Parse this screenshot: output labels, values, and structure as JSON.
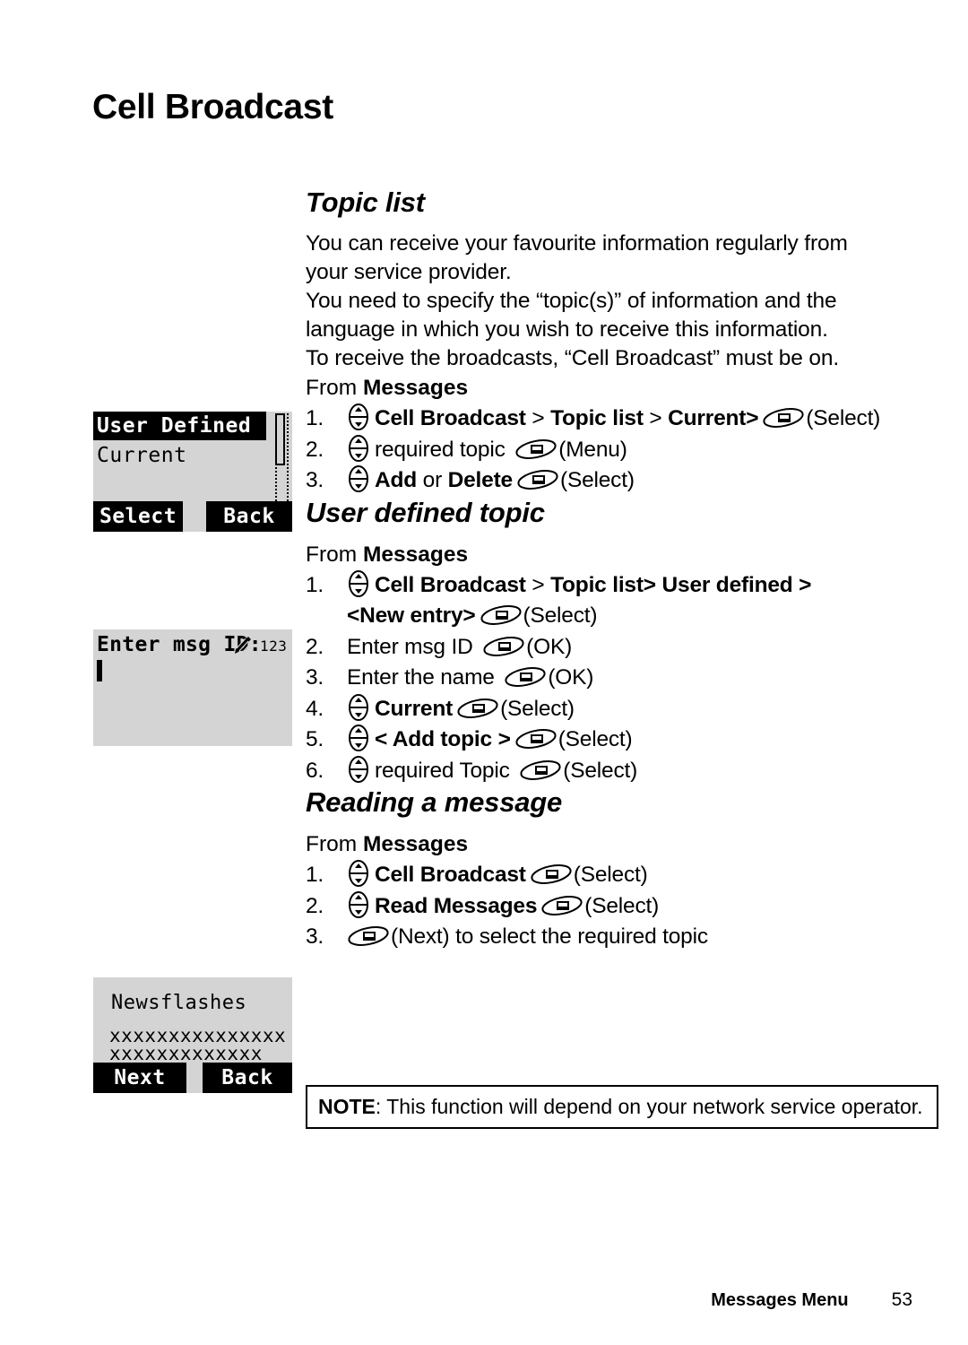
{
  "document": {
    "title": "Cell Broadcast",
    "footer": {
      "chapter": "Messages Menu",
      "page_number": "53"
    },
    "note": {
      "label": "NOTE",
      "text": ": This function will depend on your network service operator."
    }
  },
  "icons": {
    "nav_key": "nav-updown-key-icon",
    "soft_key": "softkey-icon",
    "pencil": "pencil-edit-icon"
  },
  "sections": {
    "topic_list": {
      "heading": "Topic list",
      "paragraph_lines": [
        "You can receive your favourite information regularly from",
        "your service provider.",
        "You need to specify the “topic(s)” of information and the",
        "language in which you wish to receive this information.",
        "To receive the broadcasts, “Cell Broadcast” must be on."
      ],
      "from_prefix": "From ",
      "from_target": "Messages",
      "steps": [
        {
          "num": "1.",
          "bold1": "Cell Broadcast",
          "plain1": " > ",
          "bold2": "Topic list",
          "plain2": " > ",
          "bold3": "Current>",
          "key": "(Select)"
        },
        {
          "num": "2.",
          "plain": "required topic ",
          "key": "(Menu)"
        },
        {
          "num": "3.",
          "bold1": "Add",
          "plain1": " or ",
          "bold2": "Delete",
          "key": "(Select)"
        }
      ]
    },
    "user_defined_topic": {
      "heading": "User defined topic",
      "from_prefix": "From ",
      "from_target": "Messages",
      "steps": [
        {
          "num": "1.",
          "bold1": "Cell Broadcast",
          "plain1": " > ",
          "bold2": "Topic list> User defined >",
          "line2_bold": "<New entry>",
          "key": "(Select)"
        },
        {
          "num": "2.",
          "plain": "Enter msg ID ",
          "key": "(OK)"
        },
        {
          "num": "3.",
          "plain": "Enter the name ",
          "key": "(OK)"
        },
        {
          "num": "4.",
          "bold1": "Current",
          "key": "(Select)"
        },
        {
          "num": "5.",
          "bold1": "< Add topic >",
          "key": "(Select)"
        },
        {
          "num": "6.",
          "plain": "required Topic ",
          "key": "(Select)"
        }
      ]
    },
    "reading_a_message": {
      "heading": "Reading a message",
      "from_prefix": "From ",
      "from_target": "Messages",
      "steps": [
        {
          "num": "1.",
          "bold1": "Cell Broadcast",
          "key": "(Select)"
        },
        {
          "num": "2.",
          "bold1": "Read Messages",
          "key": "(Select)"
        },
        {
          "num": "3.",
          "key": "(Next)",
          "trailing": " to select the required topic"
        }
      ]
    }
  },
  "phone_screens": {
    "topic_list_screen": {
      "selected_item": "User Defined",
      "second_item": "Current",
      "softkey_left": "Select",
      "softkey_right": "Back"
    },
    "enter_msg_id_screen": {
      "prompt": "Enter msg ID:",
      "input_mode": "123",
      "input_value": ""
    },
    "newsflashes_screen": {
      "title": "Newsflashes",
      "body_line_1": "xxxxxxxxxxxxxxx",
      "body_line_2": "xxxxxxxxxxxxx",
      "softkey_left": "Next",
      "softkey_right": "Back"
    }
  }
}
